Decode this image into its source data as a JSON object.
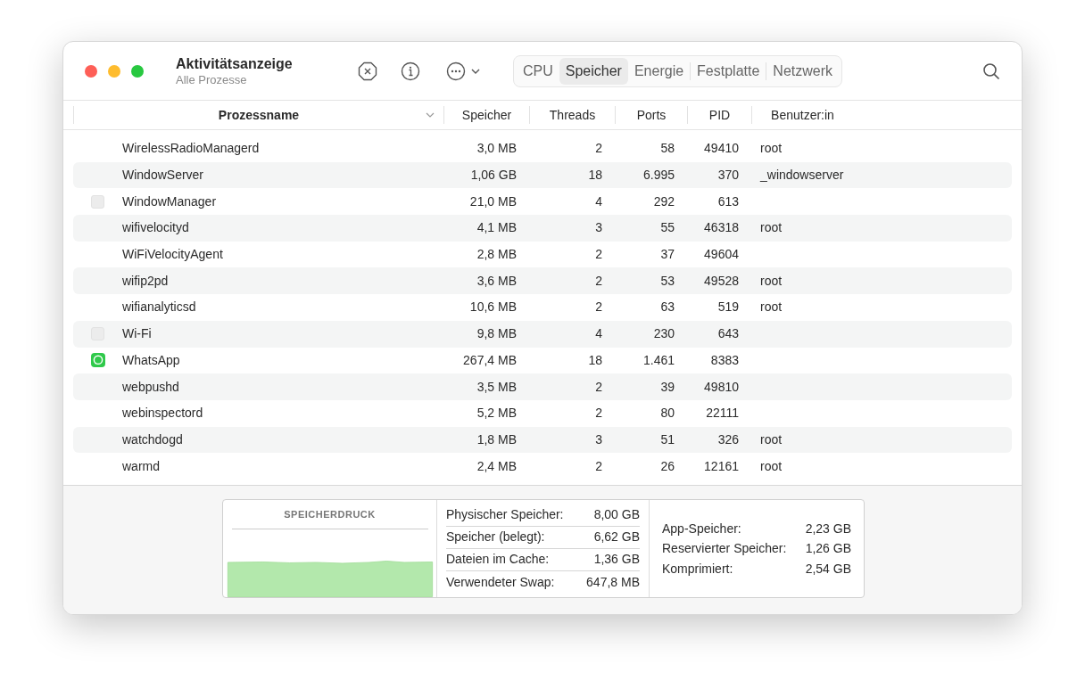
{
  "window": {
    "title": "Aktivitätsanzeige",
    "subtitle": "Alle Prozesse"
  },
  "tabs": [
    {
      "label": "CPU",
      "selected": false
    },
    {
      "label": "Speicher",
      "selected": true
    },
    {
      "label": "Energie",
      "selected": false
    },
    {
      "label": "Festplatte",
      "selected": false
    },
    {
      "label": "Netzwerk",
      "selected": false
    }
  ],
  "table": {
    "columns": [
      "Prozessname",
      "Speicher",
      "Threads",
      "Ports",
      "PID",
      "Benutzer:in"
    ],
    "rows": [
      {
        "kind": "plain",
        "cells": [
          "WirelessRadioManagerd",
          "3,0 MB",
          "2",
          "58",
          "49410",
          "root"
        ]
      },
      {
        "kind": "plain",
        "cells": [
          "WindowServer",
          "1,06 GB",
          "18",
          "6.995",
          "370",
          "_windowserver"
        ]
      },
      {
        "kind": "generic-app",
        "cells": [
          "WindowManager",
          "21,0 MB",
          "4",
          "292",
          "613",
          ""
        ]
      },
      {
        "kind": "plain",
        "cells": [
          "wifivelocityd",
          "4,1 MB",
          "3",
          "55",
          "46318",
          "root"
        ]
      },
      {
        "kind": "plain",
        "cells": [
          "WiFiVelocityAgent",
          "2,8 MB",
          "2",
          "37",
          "49604",
          ""
        ]
      },
      {
        "kind": "plain",
        "cells": [
          "wifip2pd",
          "3,6 MB",
          "2",
          "53",
          "49528",
          "root"
        ]
      },
      {
        "kind": "plain",
        "cells": [
          "wifianalyticsd",
          "10,6 MB",
          "2",
          "63",
          "519",
          "root"
        ]
      },
      {
        "kind": "generic-app",
        "cells": [
          "Wi-Fi",
          "9,8 MB",
          "4",
          "230",
          "643",
          ""
        ]
      },
      {
        "kind": "chat-app",
        "cells": [
          "WhatsApp",
          "267,4 MB",
          "18",
          "1.461",
          "8383",
          ""
        ]
      },
      {
        "kind": "plain",
        "cells": [
          "webpushd",
          "3,5 MB",
          "2",
          "39",
          "49810",
          ""
        ]
      },
      {
        "kind": "plain",
        "cells": [
          "webinspectord",
          "5,2 MB",
          "2",
          "80",
          "22111",
          ""
        ]
      },
      {
        "kind": "plain",
        "cells": [
          "watchdogd",
          "1,8 MB",
          "3",
          "51",
          "326",
          "root"
        ]
      },
      {
        "kind": "plain",
        "cells": [
          "warmd",
          "2,4 MB",
          "2",
          "26",
          "12161",
          "root"
        ]
      }
    ]
  },
  "memory": {
    "pressure_title": "SPEICHERDRUCK",
    "stats": [
      {
        "label": "Physischer Speicher:",
        "value": "8,00 GB"
      },
      {
        "label": "Speicher (belegt):",
        "value": "6,62 GB"
      },
      {
        "label": "Dateien im Cache:",
        "value": "1,36 GB"
      },
      {
        "label": "Verwendeter Swap:",
        "value": "647,8 MB"
      }
    ],
    "details": [
      {
        "label": "App-Speicher:",
        "value": "2,23 GB"
      },
      {
        "label": "Reservierter Speicher:",
        "value": "1,26 GB"
      },
      {
        "label": "Komprimiert:",
        "value": "2,54 GB"
      }
    ]
  }
}
